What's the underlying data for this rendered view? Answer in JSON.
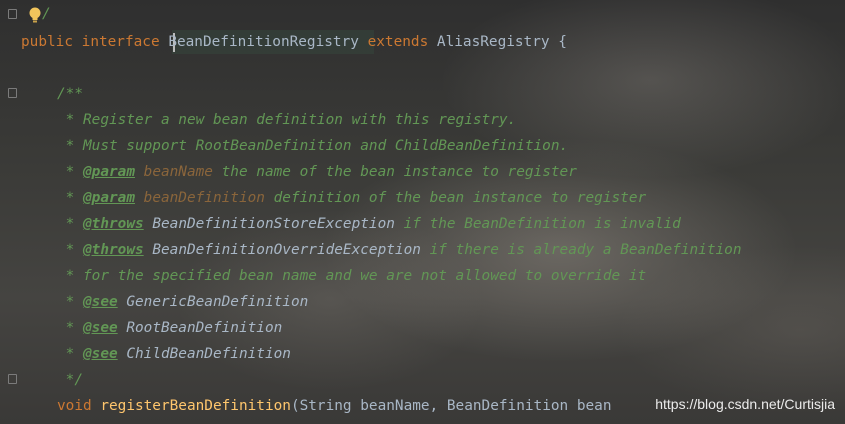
{
  "editor": {
    "line1": {
      "public": "public",
      "interface": "interface",
      "class_name": "BeanDefinitionRegistry",
      "extends": "extends",
      "parent": "AliasRegistry {"
    },
    "doc": {
      "open": "/**",
      "l1": " * Register a new bean definition with this registry.",
      "l2": " * Must support RootBeanDefinition and ChildBeanDefinition.",
      "l3": {
        "star": " * ",
        "tag": "@param",
        "param": "beanName",
        "text": " the name of the bean instance to register"
      },
      "l4": {
        "star": " * ",
        "tag": "@param",
        "param": "beanDefinition",
        "text": " definition of the bean instance to register"
      },
      "l5": {
        "star": " * ",
        "tag": "@throws",
        "ref": "BeanDefinitionStoreException",
        "text": " if the BeanDefinition is invalid"
      },
      "l6": {
        "star": " * ",
        "tag": "@throws",
        "ref": "BeanDefinitionOverrideException",
        "text": " if there is already a BeanDefinition"
      },
      "l7": " * for the specified bean name and we are not allowed to override it",
      "l8": {
        "star": " * ",
        "tag": "@see",
        "ref": "GenericBeanDefinition"
      },
      "l9": {
        "star": " * ",
        "tag": "@see",
        "ref": "RootBeanDefinition"
      },
      "l10": {
        "star": " * ",
        "tag": "@see",
        "ref": "ChildBeanDefinition"
      },
      "close": " */"
    },
    "method": {
      "void": "void",
      "name": "registerBeanDefinition",
      "rest": "(String beanName, BeanDefinition bean"
    }
  },
  "watermark": "https://blog.csdn.net/Curtisjia",
  "icons": [
    "lightbulb-icon",
    "fold-marker-icon"
  ],
  "colors": {
    "keyword": "#cc7832",
    "comment": "#629755",
    "param": "#8a653b",
    "identifier": "#a9b7c6",
    "method": "#ffc66d"
  }
}
